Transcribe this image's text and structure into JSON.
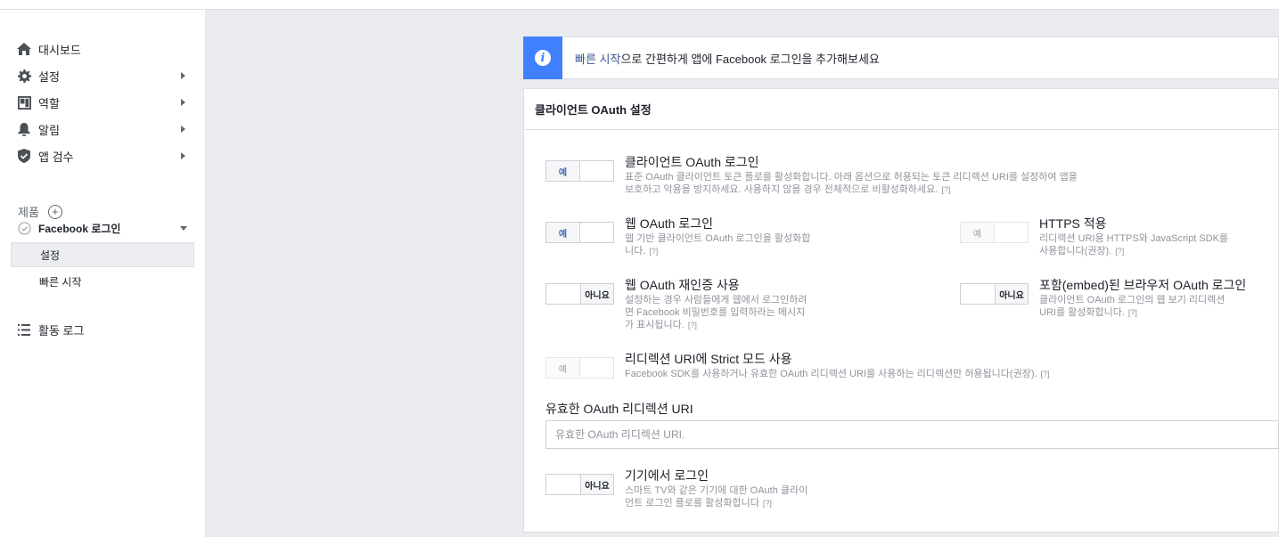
{
  "sidebar": {
    "items": [
      {
        "label": "대시보드",
        "icon": "home-icon",
        "has_arrow": false
      },
      {
        "label": "설정",
        "icon": "gear-icon",
        "has_arrow": true
      },
      {
        "label": "역할",
        "icon": "roles-icon",
        "has_arrow": true
      },
      {
        "label": "알림",
        "icon": "bell-icon",
        "has_arrow": true
      },
      {
        "label": "앱 검수",
        "icon": "shield-icon",
        "has_arrow": true
      }
    ],
    "products_label": "제품",
    "product": {
      "label": "Facebook 로그인",
      "icon": "check-circle-icon"
    },
    "sub_items": [
      {
        "label": "설정",
        "active": true
      },
      {
        "label": "빠른 시작",
        "active": false
      }
    ],
    "activity_log": {
      "label": "활동 로그",
      "icon": "list-icon"
    }
  },
  "banner": {
    "icon": "info-icon",
    "link_text": "빠른 시작",
    "text": "으로 간편하게 앱에 Facebook 로그인을 추가해보세요"
  },
  "card": {
    "title": "클라이언트 OAuth 설정",
    "options": [
      {
        "id": "client_oauth_login",
        "title": "클라이언트 OAuth 로그인",
        "desc_line1": "표준 OAuth 클라이언트 토큰 플로를 활성화합니다. 아래 옵션으로 허용되는 토큰 리디렉션 URI를 설정하여 앱을",
        "desc_line2": "보호하고 악용을 방지하세요. 사용하지 않을 경우 전체적으로 비활성화하세요.",
        "help": "[?]",
        "toggle": "예",
        "state": "on"
      },
      {
        "id": "web_oauth_login",
        "title": "웹 OAuth 로그인",
        "desc_line1": "웹 기반 클라이언트 OAuth 로그인을 활성화합",
        "desc_line2": "니다.",
        "help": "[?]",
        "toggle": "예",
        "state": "on"
      },
      {
        "id": "https_enforce",
        "title": "HTTPS 적용",
        "desc_line1": "리디렉션 URI용 HTTPS와 JavaScript SDK를",
        "desc_line2": "사용합니다(권장).",
        "help": "[?]",
        "toggle": "예",
        "state": "disabled"
      },
      {
        "id": "web_oauth_reauth",
        "title": "웹 OAuth 재인증 사용",
        "desc_line1": "설정하는 경우 사람들에게 웹에서 로그인하려",
        "desc_line2": "면 Facebook 비밀번호를 입력하라는 메시지",
        "desc_line3": "가 표시됩니다.",
        "help": "[?]",
        "toggle": "아니요",
        "state": "off"
      },
      {
        "id": "embedded_browser_oauth",
        "title": "포함(embed)된 브라우저 OAuth 로그인",
        "desc_line1": "클라이언트 OAuth 로그인의 웹 보기 리디렉션",
        "desc_line2": "URI를 활성화합니다.",
        "help": "[?]",
        "toggle": "아니요",
        "state": "off"
      },
      {
        "id": "strict_mode",
        "title": "리디렉션 URI에 Strict 모드 사용",
        "desc_line1": "Facebook SDK를 사용하거나 유효한 OAuth 리디렉션 URI를 사용하는 리디렉션만 허용됩니다(권장).",
        "help": "[?]",
        "toggle": "예",
        "state": "disabled"
      },
      {
        "id": "device_login",
        "title": "기기에서 로그인",
        "desc_line1": "스마트 TV와 같은 기기에 대한 OAuth 클라이",
        "desc_line2": "언트 로그인 플로를 활성화합니다",
        "help": "[?]",
        "toggle": "아니요",
        "state": "off"
      }
    ],
    "redirect_uri": {
      "label": "유효한 OAuth 리디렉션 URI",
      "placeholder": "유효한 OAuth 리디렉션 URI.",
      "value": ""
    }
  },
  "colors": {
    "accent": "#4080ff",
    "link": "#385898",
    "background": "#e9ebee"
  }
}
